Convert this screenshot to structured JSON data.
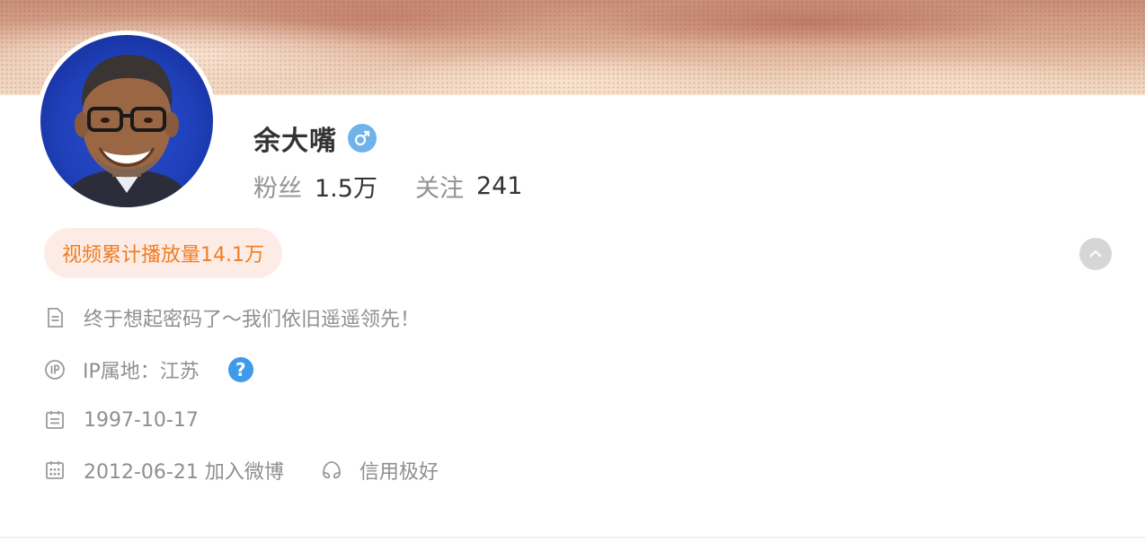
{
  "profile": {
    "name": "余大嘴",
    "gender_icon": "male-icon",
    "fans_label": "粉丝",
    "fans_value": "1.5万",
    "following_label": "关注",
    "following_value": "241"
  },
  "badge": {
    "video_plays": "视频累计播放量14.1万"
  },
  "info": {
    "bio": "终于想起密码了～我们依旧遥遥领先！",
    "ip_location": "IP属地：江苏",
    "help_glyph": "?",
    "birthday": "1997-10-17",
    "joined": "2012-06-21 加入微博",
    "credit": "信用极好"
  },
  "colors": {
    "accent_orange": "#f07d22",
    "pill_bg": "#fdece6",
    "male_badge": "#6fb3ea",
    "help_blue": "#3d9be9",
    "muted_text": "#8f8f8f"
  },
  "icons": [
    "document-icon",
    "ip-icon",
    "help-icon",
    "birthday-icon",
    "calendar-icon",
    "credit-icon",
    "chevron-up-icon"
  ]
}
